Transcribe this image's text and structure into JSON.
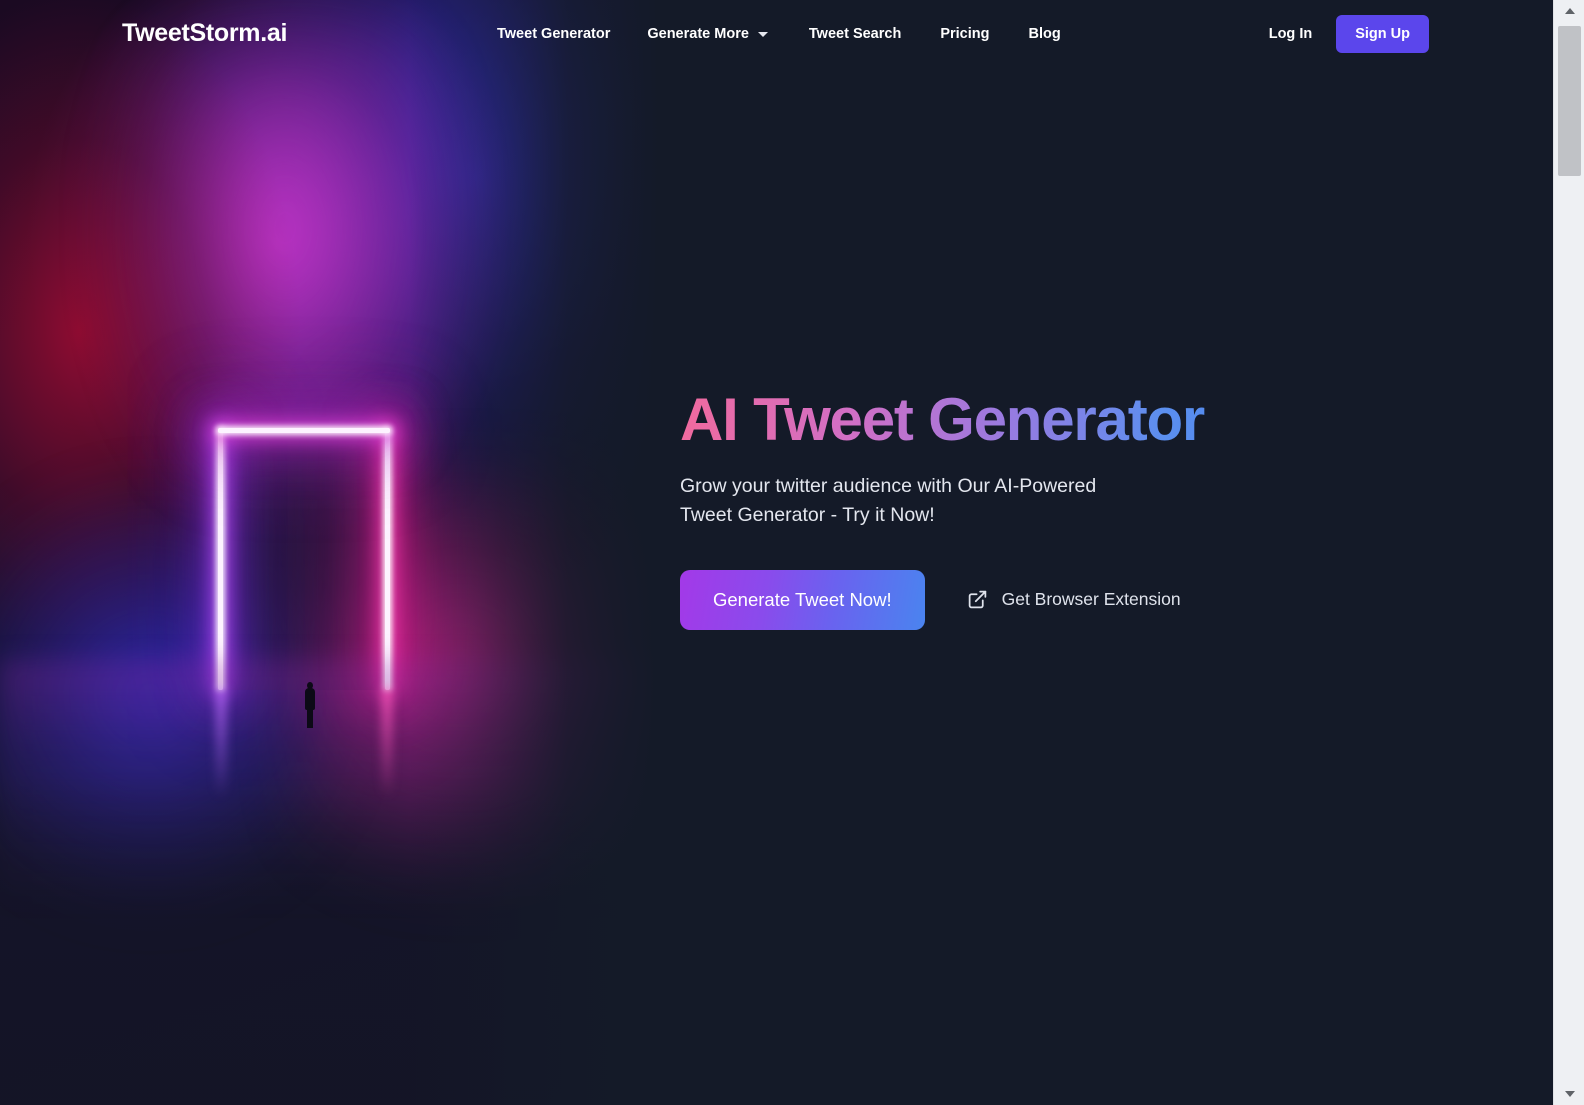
{
  "site": {
    "logo": "TweetStorm.ai",
    "background_color": "#141a28",
    "accent_color": "#5b46ec"
  },
  "header": {
    "nav": [
      {
        "label": "Tweet Generator",
        "has_dropdown": false
      },
      {
        "label": "Generate More",
        "has_dropdown": true,
        "icon": "chevron-down-icon"
      },
      {
        "label": "Tweet Search",
        "has_dropdown": false
      },
      {
        "label": "Pricing",
        "has_dropdown": false
      },
      {
        "label": "Blog",
        "has_dropdown": false
      }
    ],
    "login_label": "Log In",
    "signup_label": "Sign Up"
  },
  "hero": {
    "title": "AI Tweet Generator",
    "title_gradient_start": "#f06a9e",
    "title_gradient_end": "#4a86f0",
    "subtitle": "Grow your twitter audience with Our AI-Powered Tweet Generator - Try it Now!",
    "primary_cta": "Generate Tweet Now!",
    "primary_cta_gradient_start": "#a339e8",
    "primary_cta_gradient_end": "#4a84ef",
    "secondary_cta": "Get Browser Extension",
    "secondary_cta_icon": "external-link-icon",
    "artwork_alt": "Neon magenta and violet portal doorway with silhouetted figure walking through fog"
  },
  "scrollbar": {
    "up_icon": "scroll-up-arrow-icon",
    "down_icon": "scroll-down-arrow-icon"
  }
}
